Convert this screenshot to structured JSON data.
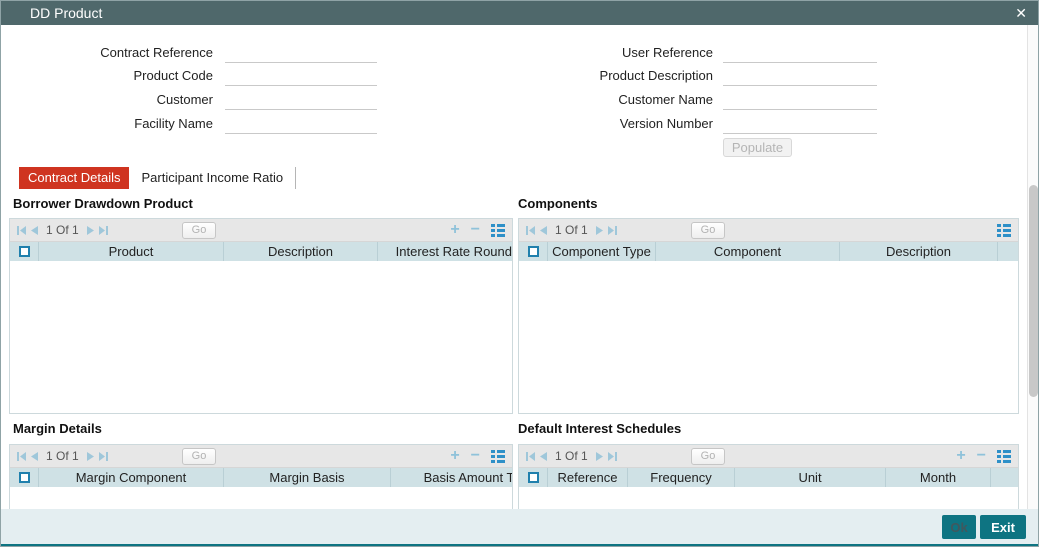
{
  "window": {
    "title": "DD Product",
    "close": "✕"
  },
  "form": {
    "left": [
      {
        "label": "Contract Reference",
        "value": ""
      },
      {
        "label": "Product Code",
        "value": ""
      },
      {
        "label": "Customer",
        "value": ""
      },
      {
        "label": "Facility Name",
        "value": ""
      }
    ],
    "right": [
      {
        "label": "User Reference",
        "value": ""
      },
      {
        "label": "Product Description",
        "value": ""
      },
      {
        "label": "Customer Name",
        "value": ""
      },
      {
        "label": "Version Number",
        "value": ""
      }
    ],
    "populate": "Populate"
  },
  "tabs": {
    "active": "Contract Details",
    "inactive": "Participant Income Ratio"
  },
  "pager": {
    "text": "1 Of 1",
    "go": "Go",
    "plus": "+",
    "minus": "−"
  },
  "sections": {
    "borrower": {
      "title": "Borrower Drawdown Product",
      "columns": [
        "Product",
        "Description",
        "Interest Rate Rounding"
      ]
    },
    "components": {
      "title": "Components",
      "columns": [
        "Component Type",
        "Component",
        "Description"
      ]
    },
    "margin": {
      "title": "Margin Details",
      "columns": [
        "Margin Component",
        "Margin Basis",
        "Basis Amount Tag"
      ]
    },
    "schedules": {
      "title": "Default Interest Schedules",
      "columns": [
        "Reference",
        "Frequency",
        "Unit",
        "Month"
      ]
    }
  },
  "footer": {
    "ok": "Ok",
    "exit": "Exit"
  },
  "colors": {
    "titlebar": "#4f686b",
    "tab_active": "#cf3420",
    "accent_teal": "#0e7482",
    "header_row": "#cfe1e5",
    "nav_icon_blue": "#9fc7da",
    "grid_icon_blue": "#2e90c8",
    "checkbox_blue": "#2080ad"
  }
}
